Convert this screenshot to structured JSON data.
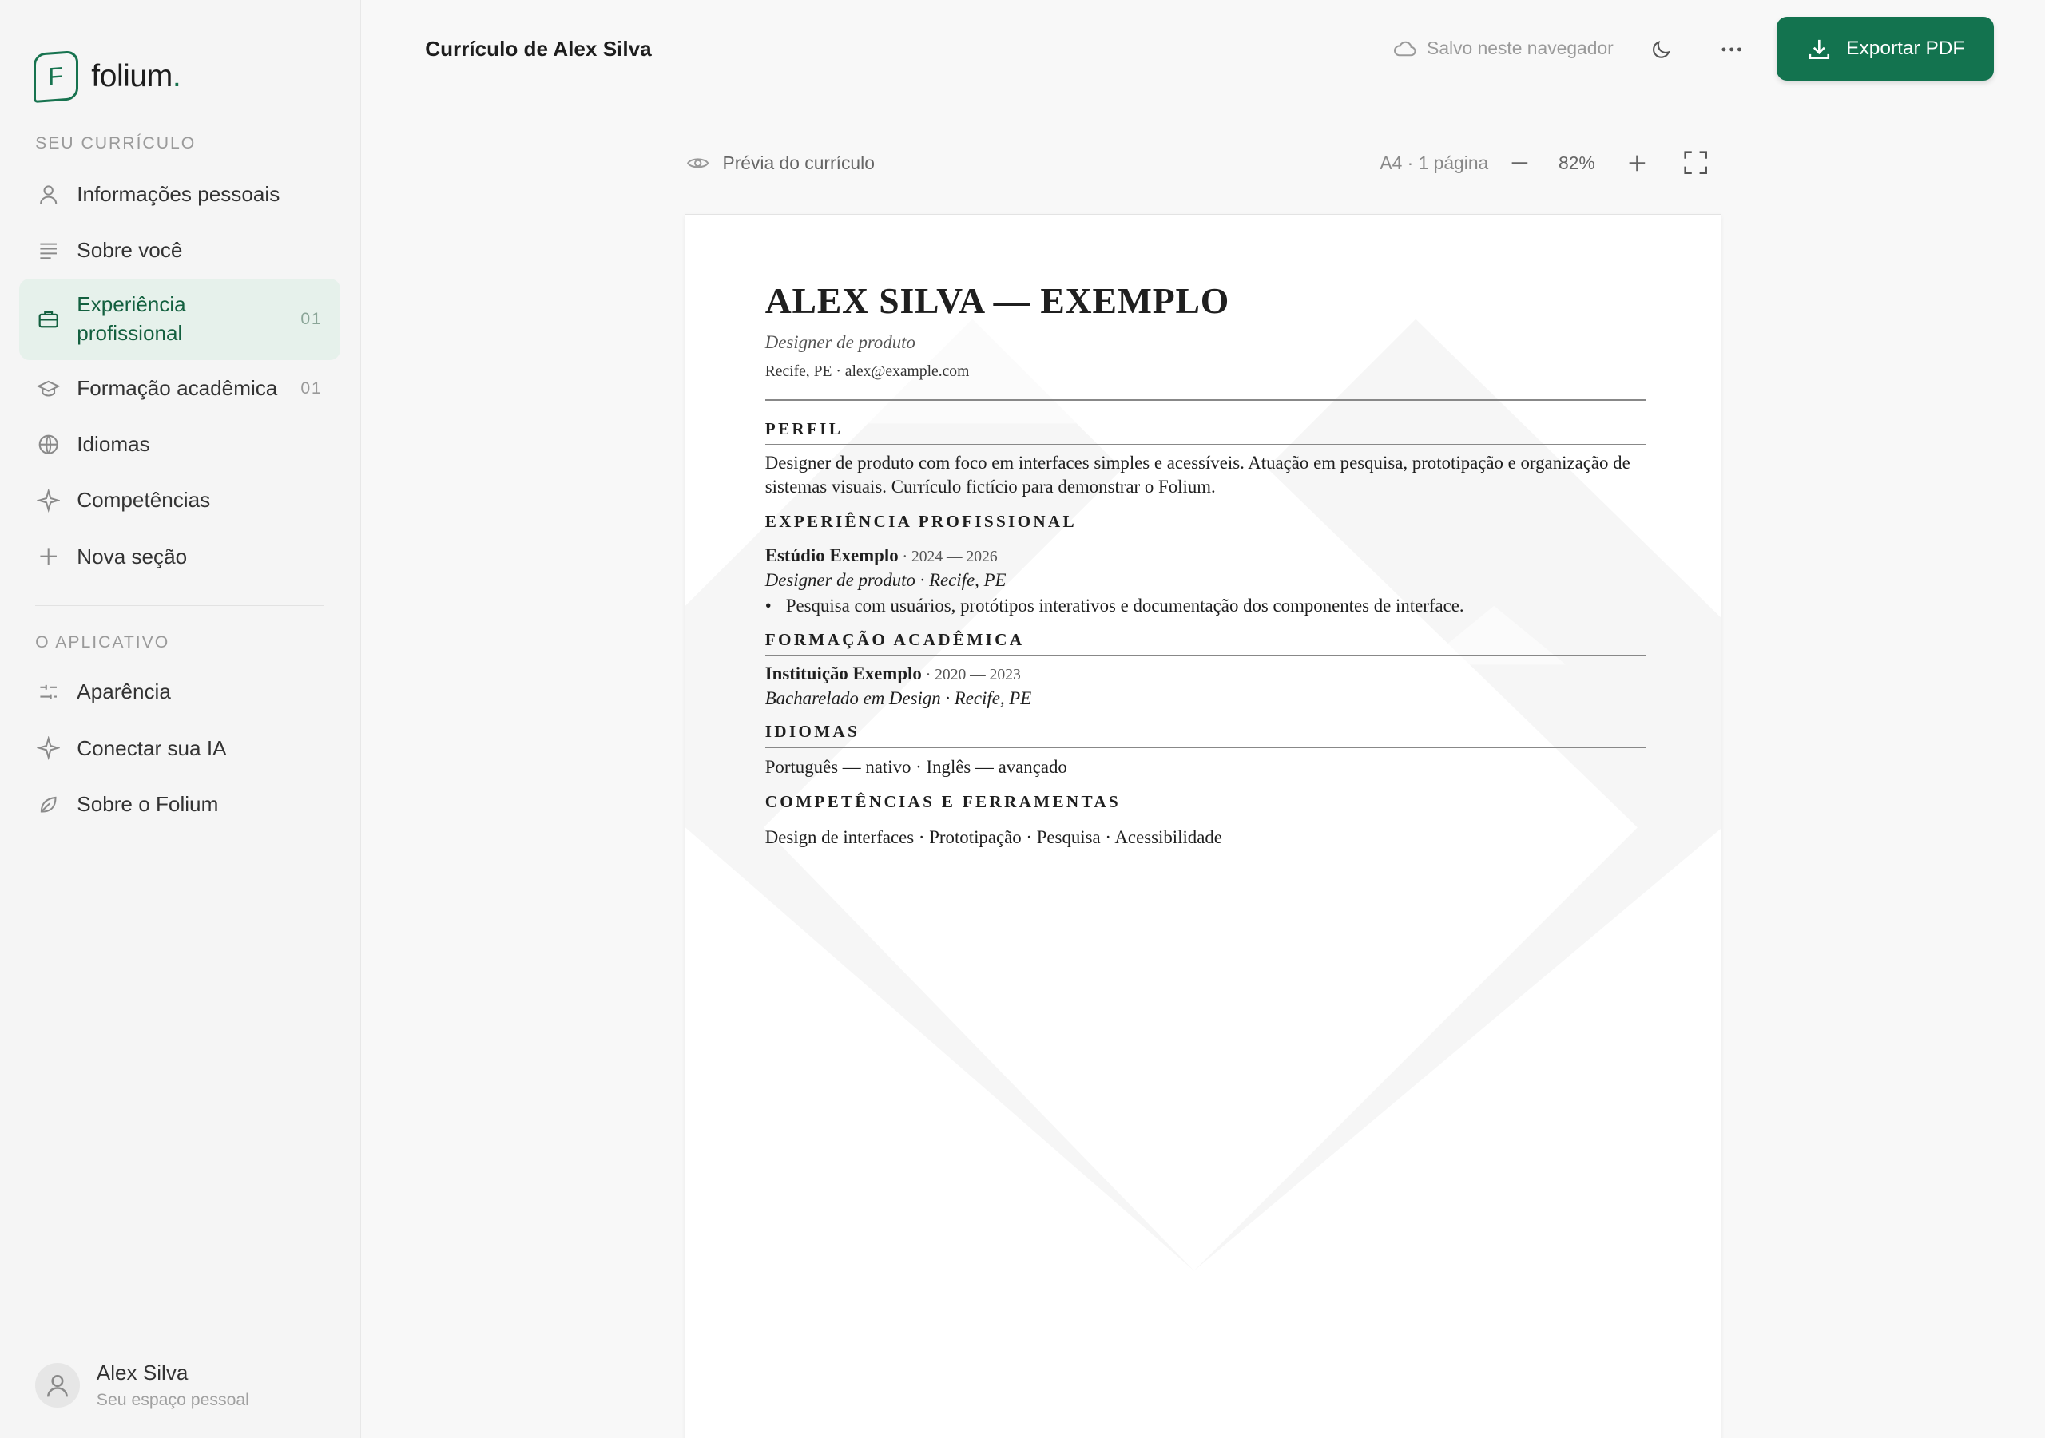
{
  "app": {
    "name": "folium",
    "logo_letter": "F",
    "accent": "#13734f"
  },
  "sidebar": {
    "section_resume": "SEU CURRÍCULO",
    "resume_items": [
      {
        "label": "Informações pessoais",
        "icon": "person-icon",
        "count": ""
      },
      {
        "label": "Sobre você",
        "icon": "text-lines-icon",
        "count": ""
      },
      {
        "label": "Experiência profissional",
        "icon": "briefcase-icon",
        "count": "01",
        "active": true
      },
      {
        "label": "Formação acadêmica",
        "icon": "graduation-cap-icon",
        "count": "01"
      },
      {
        "label": "Idiomas",
        "icon": "globe-icon",
        "count": ""
      },
      {
        "label": "Competências",
        "icon": "sparkle-icon",
        "count": ""
      },
      {
        "label": "Nova seção",
        "icon": "plus-icon",
        "count": ""
      }
    ],
    "section_app": "O APLICATIVO",
    "app_items": [
      {
        "label": "Aparência",
        "icon": "sliders-icon"
      },
      {
        "label": "Conectar sua IA",
        "icon": "sparkle-icon"
      },
      {
        "label": "Sobre o Folium",
        "icon": "leaf-icon"
      }
    ],
    "user": {
      "name": "Alex Silva",
      "subtitle": "Seu espaço pessoal"
    }
  },
  "topbar": {
    "title": "Currículo de Alex Silva",
    "save_status": "Salvo neste navegador",
    "export_label": "Exportar PDF"
  },
  "preview": {
    "label": "Prévia do currículo",
    "page_info": "A4 · 1 página",
    "zoom": "82%"
  },
  "resume": {
    "name": "ALEX SILVA — EXEMPLO",
    "role": "Designer de produto",
    "contact": "Recife, PE · alex@example.com",
    "profile_heading": "PERFIL",
    "profile_text": "Designer de produto com foco em interfaces simples e acessíveis. Atuação em pesquisa, prototipação e organização de sistemas visuais. Currículo fictício para demonstrar o Folium.",
    "experience_heading": "EXPERIÊNCIA PROFISSIONAL",
    "experience": {
      "company": "Estúdio Exemplo",
      "dates": " · 2024 — 2026",
      "subtitle": "Designer de produto · Recife, PE",
      "bullet": "Pesquisa com usuários, protótipos interativos e documentação dos componentes de interface."
    },
    "education_heading": "FORMAÇÃO ACADÊMICA",
    "education": {
      "institution": "Instituição Exemplo",
      "dates": " · 2020 — 2023",
      "subtitle": "Bacharelado em Design · Recife, PE"
    },
    "languages_heading": "IDIOMAS",
    "languages_text": "Português — nativo · Inglês — avançado",
    "skills_heading": "COMPETÊNCIAS E FERRAMENTAS",
    "skills_text": "Design de interfaces · Prototipação · Pesquisa · Acessibilidade"
  }
}
